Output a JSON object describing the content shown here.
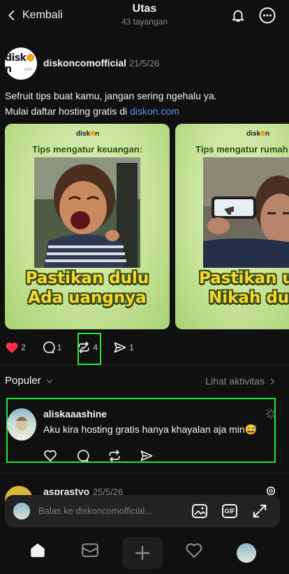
{
  "header": {
    "back_label": "Kembali",
    "title": "Utas",
    "subtitle": "43 tayangan"
  },
  "post": {
    "author": "diskoncomofficial",
    "date": "21/5/26",
    "avatar_logo": "diskon",
    "avatar_logo_suffix": ".com",
    "text_line1": "Sefruit tips buat kamu, jangan sering ngehalu ya.",
    "text_line2_prefix": "Mulai daftar hosting gratis di ",
    "link": "diskon.com",
    "images": [
      {
        "logo": "diskon",
        "heading": "Tips mengatur keuangan:",
        "caption_line1": "Pastikan dulu",
        "caption_line2": "Ada uangnya"
      },
      {
        "logo": "diskon",
        "heading": "Tips mengatur rumah",
        "caption_line1": "Pastikan u",
        "caption_line2": "Nikah du"
      }
    ],
    "stats": {
      "likes": "2",
      "replies": "1",
      "reposts": "4",
      "shares": "1"
    }
  },
  "section": {
    "populer_label": "Populer",
    "activity_label": "Lihat aktivitas"
  },
  "comments": [
    {
      "author": "aliskaaashine",
      "text": "Aku kira hosting gratis hanya khayalan aja min😅"
    },
    {
      "author": "asprastyo",
      "date": "25/5/26"
    }
  ],
  "reply_bar": {
    "placeholder": "Balas ke diskoncomofficial...",
    "gif_label": "GIF"
  },
  "colors": {
    "background": "#101010",
    "like_red": "#ff3040",
    "link_blue": "#5b8ff0",
    "highlight_green": "#22e43a",
    "card_green": "#c7e39a",
    "caption_yellow": "#f4d92f"
  },
  "icons": [
    "chevron-left-icon",
    "bell-icon",
    "more-icon",
    "heart-icon",
    "comment-icon",
    "repost-icon",
    "share-icon",
    "chevron-down-icon",
    "chevron-right-icon",
    "image-icon",
    "expand-icon",
    "home-icon",
    "inbox-icon",
    "plus-icon",
    "activity-icon"
  ]
}
